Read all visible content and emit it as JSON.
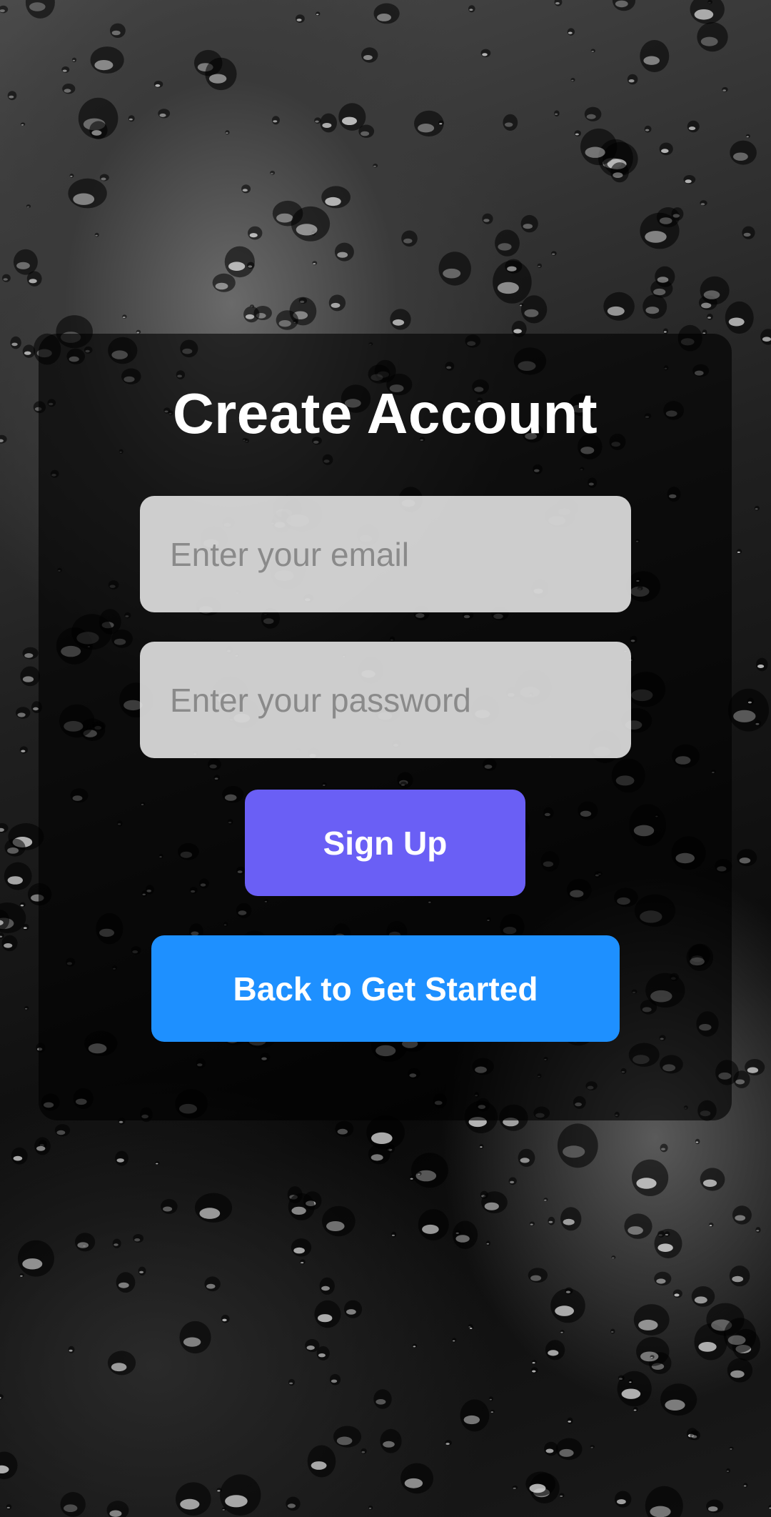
{
  "form": {
    "title": "Create Account",
    "email_placeholder": "Enter your email",
    "password_placeholder": "Enter your password",
    "signup_label": "Sign Up",
    "back_label": "Back to Get Started"
  },
  "colors": {
    "signup_button": "#6a5ff5",
    "back_button": "#1e90ff",
    "title_text": "#ffffff"
  }
}
